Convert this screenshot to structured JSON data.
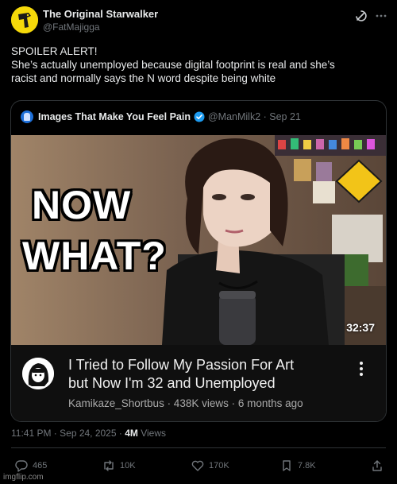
{
  "author": {
    "display_name": "The Original Starwalker",
    "handle": "@FatMajigga",
    "avatar_icon": "starwalker-avatar-icon"
  },
  "header_icons": [
    "grok-icon",
    "more-options-icon"
  ],
  "tweet": {
    "lines": [
      "SPOILER ALERT!",
      "She’s actually unemployed because digital footprint is real and she’s",
      "racist and normally says the N word despite being white"
    ]
  },
  "quote": {
    "name": "Images That Make You Feel Pain",
    "handle_date": "@ManMilk2 · Sep 21",
    "verified_color": "#1d9bf0"
  },
  "video": {
    "thumbnail_text_1": "NOW",
    "thumbnail_text_2": "WHAT?",
    "duration": "32:37",
    "title_lines": [
      "I Tried to Follow My Passion For Art",
      "but Now I'm 32 and Unemployed"
    ],
    "meta": "Kamikaze_Shortbus · 438K views · 6 months ago"
  },
  "timestamp": {
    "time_date": "11:41 PM · Sep 24, 2025 · ",
    "views_count": "4M",
    "views_label": " Views"
  },
  "actions": {
    "reply": "465",
    "repost": "10K",
    "like": "170K",
    "bookmark": "7.8K"
  },
  "watermark": "imgflip.com",
  "colors": {
    "background": "#000000",
    "text": "#e7e9ea",
    "muted": "#71767b",
    "border": "#2f3336",
    "avatar_yellow": "#f5d90a"
  }
}
